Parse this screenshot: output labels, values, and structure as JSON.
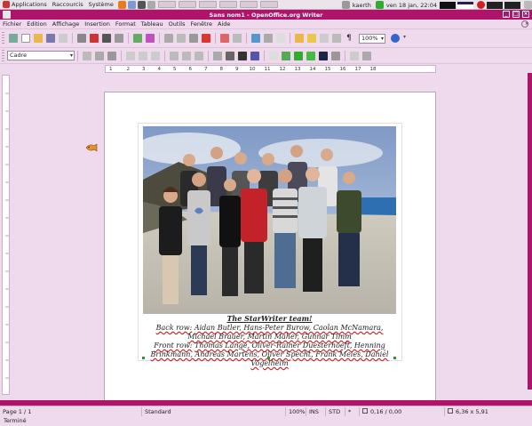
{
  "panel": {
    "applications": "Applications",
    "shortcuts": "Raccourcis",
    "system": "Système",
    "user": "kaerth",
    "clock": "ven 18 jan, 22:04"
  },
  "window": {
    "title": "Sans nom1 - OpenOffice.org Writer"
  },
  "menu": [
    "Fichier",
    "Edition",
    "Affichage",
    "Insertion",
    "Format",
    "Tableau",
    "Outils",
    "Fenêtre",
    "Aide"
  ],
  "toolbar": {
    "zoom": "100%"
  },
  "format_toolbar": {
    "style": "Cadre"
  },
  "ruler": {
    "ticks": [
      "1",
      "2",
      "3",
      "4",
      "5",
      "6",
      "7",
      "8",
      "9",
      "10",
      "11",
      "12",
      "13",
      "14",
      "15",
      "16",
      "17",
      "18"
    ]
  },
  "document": {
    "caption_title": "The StarWriter team!",
    "caption_back_label": "Back row:",
    "caption_back": "Aidan Butler, Hans-Peter Burow, Caolan McNamara, Michael Brauer, Martin Maher, Gunnar Timm",
    "caption_front_label": "Front row:",
    "caption_front": "Thomas Lange, Oliver-Rainer Duesterhoeft, Henning Brinkmann, Andreas Martens, Oliver Specht, Frank Meies, Daniel Vogelheim"
  },
  "status": {
    "page": "Page 1 / 1",
    "style": "Standard",
    "zoom": "100%",
    "ins": "INS",
    "std": "STD",
    "star": "*",
    "position": "0,16 / 0,00",
    "size": "6,36 x 5,91",
    "bottom": "Terminé"
  },
  "colors": {
    "accent": "#b0136a",
    "background": "#efd9ec"
  }
}
